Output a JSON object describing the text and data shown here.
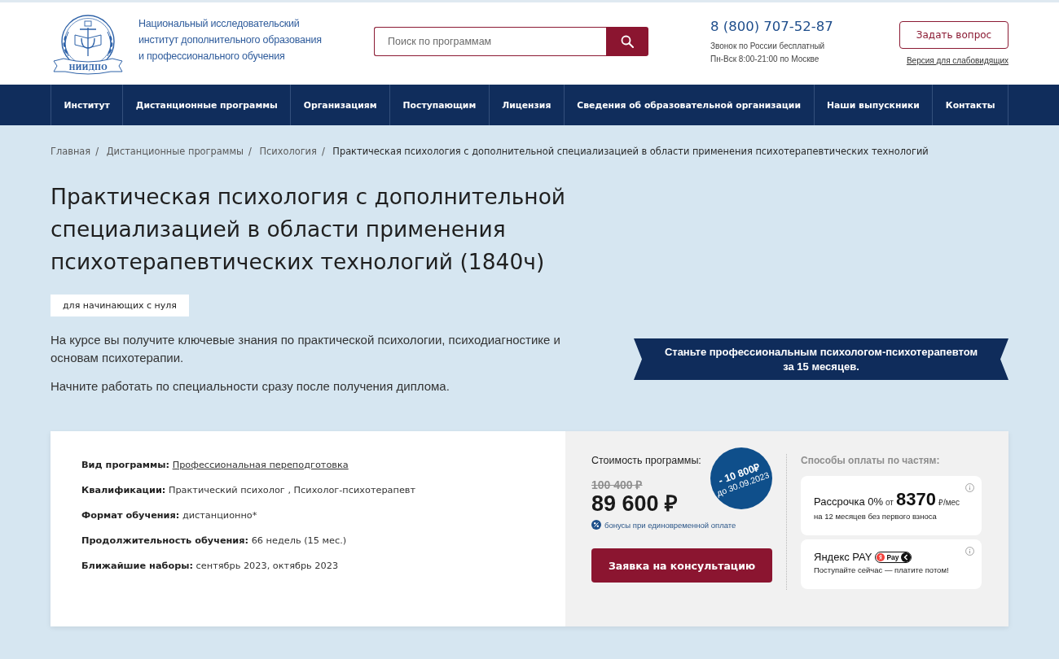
{
  "header": {
    "logo": {
      "emblem_text": "НИИДПО",
      "name_lines": [
        "Национальный исследовательский",
        "институт дополнительного образования",
        "и профессионального обучения"
      ]
    },
    "search": {
      "placeholder": "Поиск по программам"
    },
    "contact": {
      "phone": "8 (800) 707-52-87",
      "notes": [
        "Звонок по России бесплатный",
        "Пн-Вск 8:00-21:00 по Москве"
      ]
    },
    "ask_button": "Задать вопрос",
    "accessibility_link": "Версия для слабовидящих"
  },
  "nav": {
    "items": [
      "Институт",
      "Дистанционные программы",
      "Организациям",
      "Поступающим",
      "Лицензия",
      "Сведения об образовательной организации",
      "Наши выпускники",
      "Контакты"
    ]
  },
  "breadcrumb": {
    "separator": "/",
    "items": [
      "Главная",
      "Дистанционные программы",
      "Психология",
      "Практическая психология с дополнительной специализацией в области применения психотерапевтических технологий"
    ]
  },
  "course": {
    "title": "Практическая психология с дополнительной специализацией в области применения психотерапевтических технологий (1840ч)",
    "tag": "для начинающих с нуля",
    "description": [
      "На курсе вы получите ключевые знания по практической психологии, психодиагностике и основам психотерапии.",
      "Начните работать по специальности сразу после получения диплома."
    ],
    "banner_lines": [
      "Станьте профессиональным психологом-психотерапевтом",
      "за 15 месяцев."
    ]
  },
  "details": [
    {
      "kind": "link",
      "label": "Вид программы:",
      "value": "Профессиональная переподготовка"
    },
    {
      "kind": "text",
      "label": "Квалификации:",
      "value": "Практический психолог , Психолог-психотерапевт"
    },
    {
      "kind": "text",
      "label": "Формат обучения:",
      "value": "дистанционно*"
    },
    {
      "kind": "text",
      "label": "Продолжительность обучения:",
      "value": "66 недель (15 мес.)"
    },
    {
      "kind": "text",
      "label": "Ближайшие наборы:",
      "value": "сентябрь 2023, октябрь 2023"
    }
  ],
  "pricing": {
    "label": "Стоимость программы:",
    "old_price": "100 400 ₽",
    "price": "89 600 ₽",
    "discount": {
      "amount": "- 10 800₽",
      "until": "до 30.09.2023"
    },
    "bonus_note": "бонусы при единовременной оплате",
    "cta_button": "Заявка на консультацию"
  },
  "installments": {
    "heading": "Способы оплаты по частям:",
    "options": [
      {
        "kind": "installment",
        "title": "Рассрочка 0%",
        "prefix": "от",
        "amount": "8370",
        "unit": "₽/мес",
        "note": "на 12 месяцев без первого взноса"
      },
      {
        "kind": "yandex_pay",
        "title": "Яндекс PAY",
        "badge": "Pay",
        "note": "Поступайте сейчас — платите потом!"
      }
    ]
  }
}
